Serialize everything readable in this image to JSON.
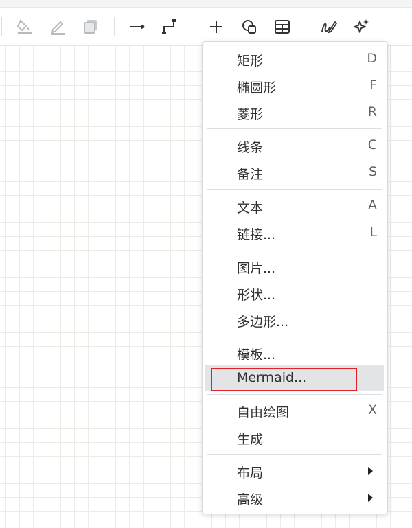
{
  "toolbar": {
    "icons": [
      "fill-color-icon",
      "line-color-icon",
      "shadow-icon",
      "connection-arrow-icon",
      "waypoints-icon",
      "insert-plus-icon",
      "shapes-icon",
      "table-icon",
      "freehand-draw-icon",
      "generate-sparkle-icon"
    ]
  },
  "menu": {
    "shape_group": [
      {
        "label": "矩形",
        "key": "D"
      },
      {
        "label": "椭圆形",
        "key": "F"
      },
      {
        "label": "菱形",
        "key": "R"
      }
    ],
    "line_group": [
      {
        "label": "线条",
        "key": "C"
      },
      {
        "label": "备注",
        "key": "S"
      }
    ],
    "text_group": [
      {
        "label": "文本",
        "key": "A"
      },
      {
        "label": "链接...",
        "key": "L"
      }
    ],
    "media_group": [
      {
        "label": "图片..."
      },
      {
        "label": "形状..."
      },
      {
        "label": "多边形..."
      }
    ],
    "template_group": [
      {
        "label": "模板..."
      },
      {
        "label": "Mermaid..."
      }
    ],
    "draw_group": [
      {
        "label": "自由绘图",
        "key": "X"
      },
      {
        "label": "生成"
      }
    ],
    "sub_group": [
      {
        "label": "布局"
      },
      {
        "label": "高级"
      }
    ]
  },
  "colors": {
    "highlight_border": "#e0232a",
    "hover_bg": "#e3e4e6"
  }
}
